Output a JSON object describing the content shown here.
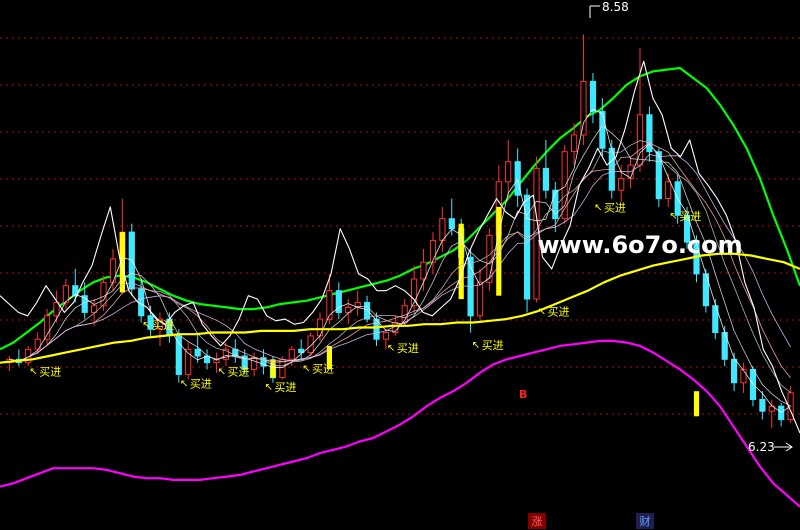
{
  "chart_data": {
    "type": "candlestick",
    "watermark": "www.6o7o.com",
    "high_label": "8.58",
    "low_label": "6.23",
    "marker_b": "B",
    "footer_tags": [
      "涨",
      "财"
    ],
    "buy_signal_label": "买进",
    "price_ylim": [
      5.8,
      8.75
    ],
    "colors": {
      "up": "#ff3030",
      "down": "#40e8ff",
      "buy_bar": "#ffff00",
      "upper_band": "#00ff00",
      "lower_band": "#ff00ff",
      "long_ma": "#ffff00",
      "fast_line": "#ffffff",
      "ma_bundle": [
        "#ffffff",
        "#e0e0e0",
        "#c0c0c0",
        "#ffb0b0",
        "#e0c0ff"
      ],
      "grid": "#a01010",
      "tag_zhang_bg": "#800000",
      "tag_cai_bg": "#202050"
    },
    "grid": true,
    "upper_band": [
      6.7,
      6.74,
      6.8,
      6.86,
      6.93,
      6.99,
      7.05,
      7.1,
      7.13,
      7.14,
      7.13,
      7.1,
      7.06,
      7.02,
      6.99,
      6.97,
      6.96,
      6.95,
      6.94,
      6.94,
      6.95,
      6.97,
      6.98,
      6.99,
      7.01,
      7.03,
      7.05,
      7.07,
      7.09,
      7.11,
      7.14,
      7.18,
      7.21,
      7.25,
      7.29,
      7.35,
      7.43,
      7.51,
      7.59,
      7.69,
      7.79,
      7.88,
      7.96,
      8.02,
      8.09,
      8.13,
      8.2,
      8.28,
      8.33,
      8.36,
      8.37,
      8.38,
      8.32,
      8.26,
      8.16,
      8.04,
      7.9,
      7.72,
      7.5,
      7.3,
      7.08
    ],
    "lower_band": [
      5.88,
      5.9,
      5.93,
      5.96,
      5.99,
      5.99,
      5.99,
      5.99,
      5.98,
      5.96,
      5.94,
      5.93,
      5.93,
      5.92,
      5.92,
      5.92,
      5.93,
      5.94,
      5.95,
      5.97,
      5.99,
      6.01,
      6.03,
      6.05,
      6.08,
      6.1,
      6.12,
      6.15,
      6.17,
      6.21,
      6.25,
      6.3,
      6.36,
      6.41,
      6.45,
      6.5,
      6.56,
      6.61,
      6.64,
      6.66,
      6.68,
      6.7,
      6.72,
      6.73,
      6.74,
      6.75,
      6.75,
      6.74,
      6.72,
      6.68,
      6.63,
      6.58,
      6.52,
      6.45,
      6.36,
      6.24,
      6.12,
      6.0,
      5.9,
      5.83,
      5.76
    ],
    "long_ma": [
      6.62,
      6.63,
      6.64,
      6.66,
      6.68,
      6.7,
      6.72,
      6.74,
      6.75,
      6.77,
      6.78,
      6.79,
      6.79,
      6.8,
      6.8,
      6.8,
      6.81,
      6.81,
      6.81,
      6.82,
      6.82,
      6.82,
      6.83,
      6.83,
      6.84,
      6.84,
      6.85,
      6.85,
      6.86,
      6.86,
      6.87,
      6.88,
      6.9,
      6.93,
      6.97,
      7.01,
      7.05,
      7.1,
      7.14,
      7.17,
      7.2,
      7.22,
      7.24,
      7.26,
      7.27,
      7.27,
      7.26,
      7.24,
      7.22,
      7.18
    ],
    "fast_line": [
      7.02,
      6.97,
      6.92,
      6.9,
      6.98,
      7.08,
      7.0,
      6.92,
      6.98,
      7.1,
      7.2,
      7.38,
      7.55,
      7.25,
      7.05,
      6.98,
      6.95,
      6.88,
      6.85,
      6.92,
      6.96,
      6.98,
      6.85,
      6.78,
      6.72,
      6.78,
      6.88,
      7.02,
      7.0,
      6.9,
      6.87,
      6.88,
      6.85,
      6.86,
      6.92,
      7.0,
      7.15,
      7.42,
      7.3,
      7.15,
      7.12,
      7.05,
      7.05,
      7.08,
      7.05,
      7.0,
      6.92,
      6.9,
      6.95,
      7.0,
      7.12,
      7.28,
      7.4,
      7.5,
      7.6,
      7.52,
      7.48,
      7.58,
      7.62,
      7.25,
      7.18,
      7.32,
      7.44,
      7.68,
      7.78,
      7.9,
      7.8,
      7.85,
      8.02,
      8.24,
      8.42,
      8.2,
      8.1,
      7.9,
      7.85,
      7.95,
      7.75,
      7.68,
      7.6,
      7.5,
      7.35,
      7.1,
      6.95,
      6.7,
      6.6,
      6.45,
      6.33,
      6.2
    ],
    "ohlc": [
      [
        6.62,
        6.66,
        6.57,
        6.64
      ],
      [
        6.64,
        6.7,
        6.6,
        6.62
      ],
      [
        6.62,
        6.72,
        6.6,
        6.7
      ],
      [
        6.7,
        6.8,
        6.67,
        6.76
      ],
      [
        6.76,
        6.94,
        6.72,
        6.9
      ],
      [
        6.9,
        7.05,
        6.86,
        6.98
      ],
      [
        6.98,
        7.12,
        6.94,
        7.08
      ],
      [
        7.08,
        7.18,
        6.98,
        7.02
      ],
      [
        7.02,
        7.1,
        6.88,
        6.92
      ],
      [
        6.92,
        7.0,
        6.84,
        6.96
      ],
      [
        6.96,
        7.14,
        6.93,
        7.1
      ],
      [
        7.1,
        7.3,
        7.05,
        7.24
      ],
      [
        7.24,
        7.6,
        7.2,
        7.4
      ],
      [
        7.4,
        7.45,
        7.02,
        7.06
      ],
      [
        7.06,
        7.12,
        6.86,
        6.9
      ],
      [
        6.9,
        6.96,
        6.78,
        6.82
      ],
      [
        6.82,
        6.92,
        6.72,
        6.88
      ],
      [
        6.88,
        6.92,
        6.74,
        6.78
      ],
      [
        6.78,
        6.82,
        6.5,
        6.55
      ],
      [
        6.55,
        6.74,
        6.52,
        6.7
      ],
      [
        6.7,
        6.8,
        6.62,
        6.66
      ],
      [
        6.66,
        6.7,
        6.58,
        6.62
      ],
      [
        6.62,
        6.68,
        6.56,
        6.64
      ],
      [
        6.64,
        6.74,
        6.6,
        6.7
      ],
      [
        6.7,
        6.76,
        6.62,
        6.66
      ],
      [
        6.66,
        6.7,
        6.55,
        6.58
      ],
      [
        6.58,
        6.68,
        6.54,
        6.65
      ],
      [
        6.65,
        6.7,
        6.55,
        6.6
      ],
      [
        6.6,
        6.66,
        6.5,
        6.53
      ],
      [
        6.53,
        6.66,
        6.52,
        6.64
      ],
      [
        6.64,
        6.72,
        6.6,
        6.7
      ],
      [
        6.7,
        6.76,
        6.64,
        6.68
      ],
      [
        6.68,
        6.8,
        6.66,
        6.78
      ],
      [
        6.78,
        6.92,
        6.75,
        6.88
      ],
      [
        6.88,
        7.15,
        6.85,
        7.05
      ],
      [
        7.05,
        7.1,
        6.88,
        6.92
      ],
      [
        6.92,
        7.0,
        6.85,
        6.95
      ],
      [
        6.95,
        7.05,
        6.9,
        6.98
      ],
      [
        6.98,
        7.02,
        6.86,
        6.88
      ],
      [
        6.88,
        6.92,
        6.72,
        6.76
      ],
      [
        6.76,
        6.82,
        6.7,
        6.8
      ],
      [
        6.8,
        6.9,
        6.78,
        6.86
      ],
      [
        6.86,
        7.0,
        6.84,
        6.96
      ],
      [
        6.96,
        7.2,
        6.92,
        7.12
      ],
      [
        7.12,
        7.3,
        7.05,
        7.22
      ],
      [
        7.22,
        7.4,
        7.15,
        7.35
      ],
      [
        7.35,
        7.55,
        7.28,
        7.48
      ],
      [
        7.48,
        7.6,
        7.38,
        7.42
      ],
      [
        7.42,
        7.48,
        7.2,
        7.25
      ],
      [
        7.25,
        7.3,
        6.8,
        6.9
      ],
      [
        6.9,
        7.18,
        6.88,
        7.1
      ],
      [
        7.1,
        7.42,
        7.05,
        7.38
      ],
      [
        7.38,
        7.8,
        7.32,
        7.7
      ],
      [
        7.7,
        7.95,
        7.6,
        7.82
      ],
      [
        7.82,
        7.9,
        7.55,
        7.62
      ],
      [
        7.62,
        7.66,
        6.92,
        7.0
      ],
      [
        7.0,
        7.85,
        6.98,
        7.78
      ],
      [
        7.78,
        7.95,
        7.6,
        7.65
      ],
      [
        7.65,
        7.7,
        7.4,
        7.48
      ],
      [
        7.48,
        7.92,
        7.45,
        7.88
      ],
      [
        7.88,
        8.05,
        7.8,
        7.98
      ],
      [
        7.98,
        8.58,
        7.92,
        8.3
      ],
      [
        8.3,
        8.35,
        8.05,
        8.12
      ],
      [
        8.12,
        8.2,
        7.85,
        7.9
      ],
      [
        7.9,
        7.95,
        7.6,
        7.65
      ],
      [
        7.65,
        7.8,
        7.58,
        7.72
      ],
      [
        7.72,
        7.85,
        7.66,
        7.8
      ],
      [
        7.8,
        8.5,
        7.76,
        8.1
      ],
      [
        8.1,
        8.15,
        7.82,
        7.88
      ],
      [
        7.88,
        7.9,
        7.55,
        7.6
      ],
      [
        7.6,
        7.75,
        7.55,
        7.7
      ],
      [
        7.7,
        7.74,
        7.45,
        7.5
      ],
      [
        7.5,
        7.55,
        7.3,
        7.34
      ],
      [
        7.34,
        7.38,
        7.1,
        7.15
      ],
      [
        7.15,
        7.18,
        6.92,
        6.96
      ],
      [
        6.96,
        7.0,
        6.76,
        6.8
      ],
      [
        6.8,
        6.84,
        6.6,
        6.64
      ],
      [
        6.64,
        6.68,
        6.45,
        6.5
      ],
      [
        6.5,
        6.62,
        6.44,
        6.58
      ],
      [
        6.58,
        6.6,
        6.36,
        6.4
      ],
      [
        6.4,
        6.45,
        6.28,
        6.33
      ],
      [
        6.33,
        6.4,
        6.23,
        6.36
      ],
      [
        6.36,
        6.38,
        6.24,
        6.28
      ],
      [
        6.28,
        6.48,
        6.26,
        6.44
      ]
    ],
    "yellow_bars": [
      [
        12,
        7.04,
        7.4
      ],
      [
        28,
        6.64,
        6.53
      ],
      [
        34,
        6.58,
        6.72
      ],
      [
        48,
        7.45,
        7.0
      ],
      [
        52,
        7.55,
        7.02
      ],
      [
        73,
        6.45,
        6.3
      ]
    ],
    "buy_signals": [
      [
        2,
        6.62
      ],
      [
        14,
        6.9
      ],
      [
        18,
        6.55
      ],
      [
        22,
        6.62
      ],
      [
        27,
        6.53
      ],
      [
        31,
        6.64
      ],
      [
        40,
        6.76
      ],
      [
        49,
        6.78
      ],
      [
        56,
        6.98
      ],
      [
        62,
        7.6
      ],
      [
        70,
        7.55
      ],
      [
        84,
        6.3
      ]
    ]
  }
}
